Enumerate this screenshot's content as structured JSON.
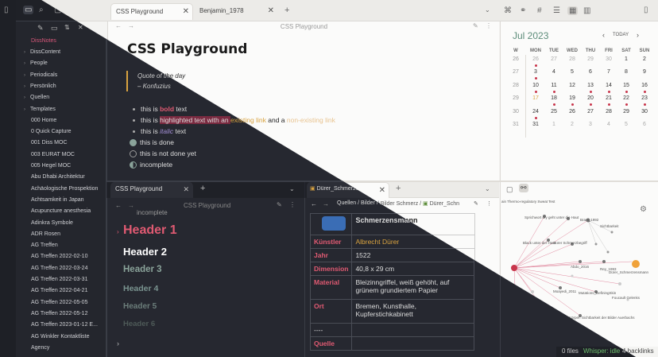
{
  "tabs_top": [
    {
      "label": "CSS Playground",
      "active": true
    },
    {
      "label": "Benjamin_1978",
      "active": false
    }
  ],
  "editor_top": {
    "nav_title": "CSS Playground",
    "title": "CSS Playground",
    "quote_line1": "Quote of the day",
    "quote_line2": "– Konfuzius",
    "list": {
      "r1_pre": "this is ",
      "r1_em": "bold",
      "r1_post": " text",
      "r2_pre": "this is ",
      "r2_hl": "highlighted text with an ",
      "r2_link": "existing link",
      "r2_mid": " and a ",
      "r2_link2": "non-existing link",
      "r3_pre": "this is ",
      "r3_em": "italic",
      "r3_post": " text",
      "t1": "this is done",
      "t2": "this is not done yet",
      "t3": "incomplete"
    }
  },
  "calendar": {
    "month": "Jul 2023",
    "today_btn": "TODAY",
    "dow": [
      "W",
      "MON",
      "TUE",
      "WED",
      "THU",
      "FRI",
      "SAT",
      "SUN"
    ],
    "rows": [
      [
        "26",
        "26",
        "27",
        "28",
        "29",
        "30",
        "1",
        "2"
      ],
      [
        "27",
        "3",
        "4",
        "5",
        "6",
        "7",
        "8",
        "9"
      ],
      [
        "28",
        "10",
        "11",
        "12",
        "13",
        "14",
        "15",
        "16"
      ],
      [
        "29",
        "17",
        "18",
        "19",
        "20",
        "21",
        "22",
        "23"
      ],
      [
        "30",
        "24",
        "25",
        "26",
        "27",
        "28",
        "29",
        "30"
      ],
      [
        "31",
        "31",
        "1",
        "2",
        "3",
        "4",
        "5",
        "6"
      ]
    ]
  },
  "tabs_bottom_left": [
    {
      "label": "CSS Playground"
    }
  ],
  "tabs_bottom_right": [
    {
      "label": "Dürer_Schmerzensman..."
    }
  ],
  "bottom_left": {
    "nav_title": "CSS Playground",
    "incomplete": "incomplete"
  },
  "headers": [
    "Header 1",
    "Header 2",
    "Header 3",
    "Header 4",
    "Header 5",
    "Header 6"
  ],
  "breadcrumb": {
    "b1": "Quellen",
    "b2": "Bilder",
    "b3": "Bilder Schmerz",
    "b4": "Dürer_Schn"
  },
  "artwork_table": {
    "title": "Schmerzensmann",
    "rows": [
      {
        "key": "Künstler",
        "value": "Albrecht Dürer"
      },
      {
        "key": "Jahr",
        "value": "1522"
      },
      {
        "key": "Dimension",
        "value": "40,8 x 29 cm"
      },
      {
        "key": "Material",
        "value": "Bleizinngriffel, weiß gehöht, auf grünem grundiertem Papier"
      },
      {
        "key": "Ort",
        "value": "Bremen, Kunsthalle, Kupferstichkabinett"
      },
      {
        "key": "----",
        "value": ""
      },
      {
        "key": "Quelle",
        "value": ""
      }
    ]
  },
  "graph_labels": {
    "l0": "ain Thermo-regulatory Sweat Test",
    "l1": "Sprichwort dry geht unter die Haut",
    "l2": "Brant_1992",
    "l3": "Sichtbarkeit",
    "l4": "Black unter der Haut",
    "l5": "Dürer Schmerzbegriff",
    "l6": "Abdo_2016",
    "l7": "Rey_1993",
    "l8": "Dürer_Schmerzensmann",
    "l9": "Moayedi_2011",
    "l10": "Foucault Gelenks",
    "l11": "Mutations_DefiningSkin",
    "l12": "Bodies Matter Conference",
    "l13": "Körper: Sichtbarkeit der Bilder Auerbachs",
    "l14": "Hybride Manifestation",
    "l15": "Kiosk, Erste Vorstellungen vom topical",
    "l16": "ermalm/Kartell",
    "l17": "nd in the Ital Vision"
  },
  "status": {
    "files": "0 files",
    "whisper": "Whisper: idle",
    "backlinks": "4 backlinks"
  },
  "sidebar": {
    "root": "DissNotes",
    "items": [
      {
        "label": "DissContent",
        "folder": true
      },
      {
        "label": "People",
        "folder": true
      },
      {
        "label": "Periodicals",
        "folder": true
      },
      {
        "label": "Persönlich",
        "folder": true
      },
      {
        "label": "Quellen",
        "folder": true
      },
      {
        "label": "Templates",
        "folder": true
      },
      {
        "label": "000 Home",
        "folder": false
      },
      {
        "label": "0 Quick Capture",
        "folder": false
      },
      {
        "label": "001 Diss MOC",
        "folder": false
      },
      {
        "label": "003 EURAT MOC",
        "folder": false
      },
      {
        "label": "005 Hegel MOC",
        "folder": false
      },
      {
        "label": "Abu Dhabi Architektur",
        "folder": false
      },
      {
        "label": "Achäologische Prospektion",
        "folder": false
      },
      {
        "label": "Achtsamkeit in Japan",
        "folder": false
      },
      {
        "label": "Acupuncture anesthesia",
        "folder": false
      },
      {
        "label": "Adinkra Symbole",
        "folder": false
      },
      {
        "label": "ADR Rosen",
        "folder": false
      },
      {
        "label": "AG Treffen",
        "folder": false
      },
      {
        "label": "AG Treffen 2022-02-10",
        "folder": false
      },
      {
        "label": "AG Treffen 2022-03-24",
        "folder": false
      },
      {
        "label": "AG Treffen 2022-03-31",
        "folder": false
      },
      {
        "label": "AG Treffen 2022-04-21",
        "folder": false
      },
      {
        "label": "AG Treffen 2022-05-05",
        "folder": false
      },
      {
        "label": "AG Treffen 2022-05-12",
        "folder": false
      },
      {
        "label": "AG Treffen 2023-01-12 E...",
        "folder": false
      },
      {
        "label": "AG Winkler Kontaktliste",
        "folder": false
      },
      {
        "label": "Agency",
        "folder": false
      }
    ]
  },
  "colors": {
    "accent_red": "#c8354b",
    "accent_orange": "#d9a340",
    "calendar_green": "#5d8d7a",
    "dark_bg": "#262830"
  }
}
